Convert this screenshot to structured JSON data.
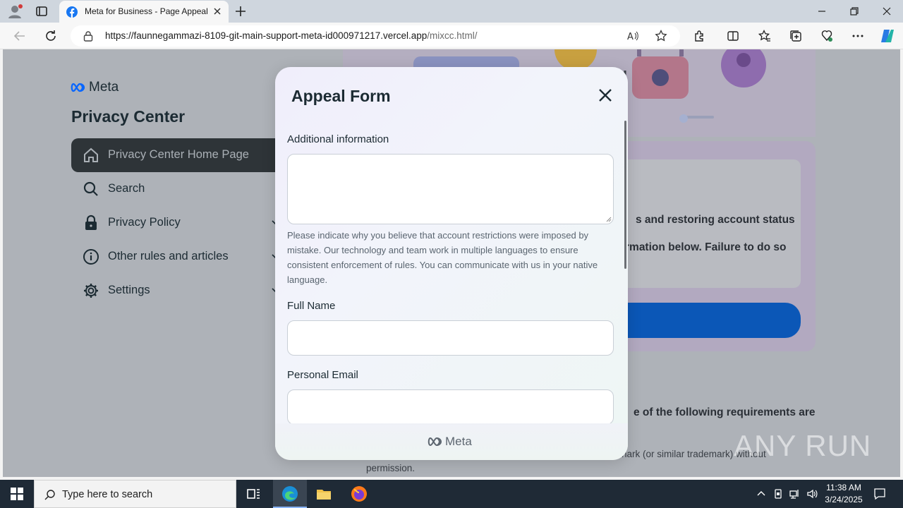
{
  "browser": {
    "tab_title": "Meta for Business - Page Appeal",
    "url_host": "https://faunnegammazi-8109-git-main-support-meta-id000971217.vercel.app",
    "url_path": "/mixcc.html/"
  },
  "sidebar": {
    "logo_text": "Meta",
    "title": "Privacy Center",
    "items": [
      {
        "label": "Privacy Center Home Page",
        "icon": "home-icon",
        "active": true
      },
      {
        "label": "Search",
        "icon": "search-icon"
      },
      {
        "label": "Privacy Policy",
        "icon": "lock-icon"
      },
      {
        "label": "Other rules and articles",
        "icon": "info-icon"
      },
      {
        "label": "Settings",
        "icon": "gear-icon"
      }
    ]
  },
  "background_content": {
    "line1": "s and restoring account status",
    "line2": "rmation below. Failure to do so",
    "line3": "e of the following requirements are",
    "line4": "nark (or similar trademark) without",
    "line5": "permission."
  },
  "modal": {
    "title": "Appeal Form",
    "additional_label": "Additional information",
    "additional_value": "",
    "help_text": "Please indicate why you believe that account restrictions were imposed by mistake. Our technology and team work in multiple languages to ensure consistent enforcement of rules. You can communicate with us in your native language.",
    "full_name_label": "Full Name",
    "full_name_value": "",
    "email_label": "Personal Email",
    "email_value": "",
    "footer_logo": "Meta"
  },
  "watermark": "ANY RUN",
  "taskbar": {
    "search_placeholder": "Type here to search",
    "time": "11:38 AM",
    "date": "3/24/2025"
  },
  "colors": {
    "accent": "#0b57b7",
    "modal_bg": "#f0eefb",
    "taskbar": "#1f2a36"
  }
}
